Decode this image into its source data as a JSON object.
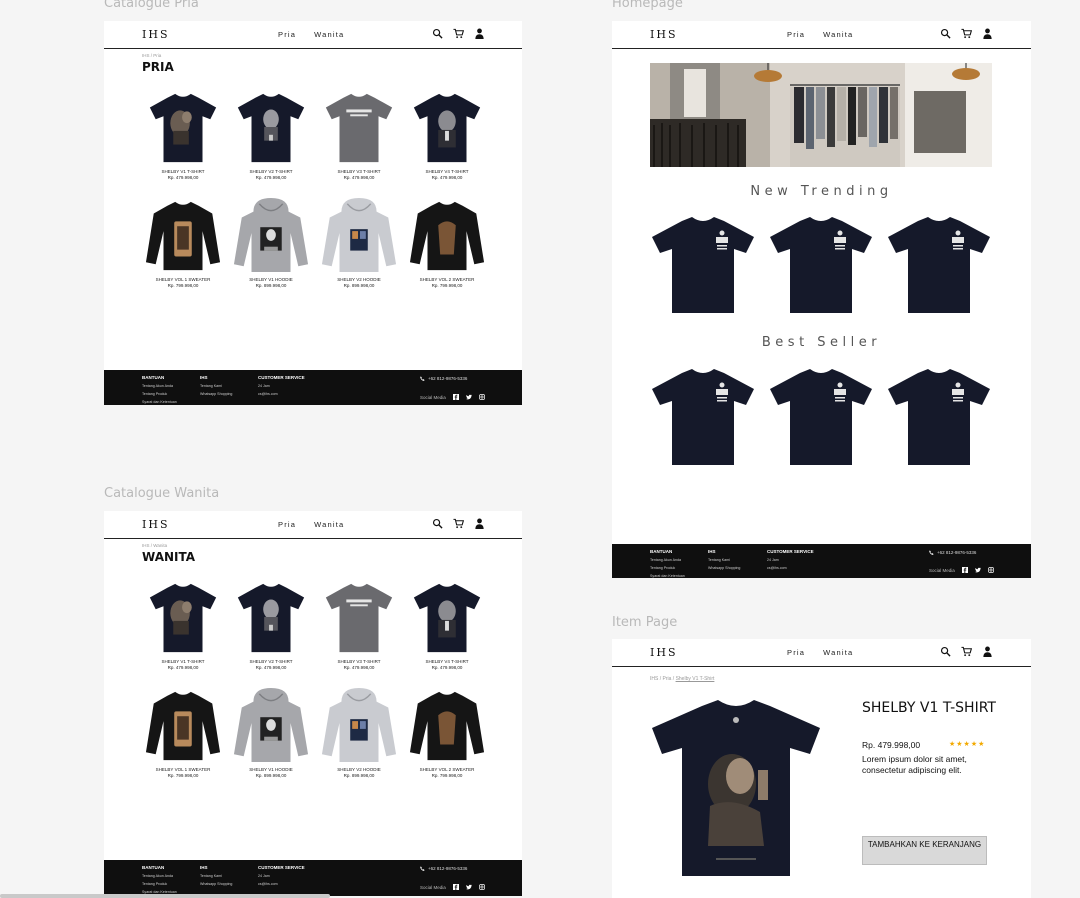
{
  "brand": "IHS",
  "nav": [
    "Pria",
    "Wanita"
  ],
  "frames": {
    "catalogue_pria": {
      "label": "Catalogue Pria",
      "breadcrumb": "IHS / Pria",
      "title": "PRIA",
      "products": [
        {
          "name": "SHELBY V1 T-SHIRT",
          "price": "Rp. 479.998,00",
          "kind": "tee-dark",
          "art": "portrait1"
        },
        {
          "name": "SHELBY V2 T-SHIRT",
          "price": "Rp. 479.998,00",
          "kind": "tee-dark",
          "art": "portrait2"
        },
        {
          "name": "SHELBY V3 T-SHIRT",
          "price": "Rp. 479.998,00",
          "kind": "tee-grey",
          "art": "text"
        },
        {
          "name": "SHELBY V4 T-SHIRT",
          "price": "Rp. 479.998,00",
          "kind": "tee-dark",
          "art": "portrait3"
        },
        {
          "name": "SHELBY VOL 1 SWEATER",
          "price": "Rp. 799.998,00",
          "kind": "sweater",
          "art": "tan"
        },
        {
          "name": "SHELBY V1 HOODIE",
          "price": "Rp. 899.998,00",
          "kind": "hoodie-grey",
          "art": "photo"
        },
        {
          "name": "SHELBY V2 HOODIE",
          "price": "Rp. 899.998,00",
          "kind": "hoodie-light",
          "art": "poster"
        },
        {
          "name": "SHELBY VOL 2 SWEATER",
          "price": "Rp. 799.998,00",
          "kind": "sweater",
          "art": "brown"
        }
      ]
    },
    "catalogue_wanita": {
      "label": "Catalogue Wanita",
      "breadcrumb": "IHS / Wanita",
      "title": "WANITA",
      "products": [
        {
          "name": "SHELBY V1 T-SHIRT",
          "price": "Rp. 479.998,00",
          "kind": "tee-dark",
          "art": "portrait1"
        },
        {
          "name": "SHELBY V2 T-SHIRT",
          "price": "Rp. 479.998,00",
          "kind": "tee-dark",
          "art": "portrait2"
        },
        {
          "name": "SHELBY V3 T-SHIRT",
          "price": "Rp. 479.998,00",
          "kind": "tee-grey",
          "art": "text"
        },
        {
          "name": "SHELBY V4 T-SHIRT",
          "price": "Rp. 479.998,00",
          "kind": "tee-dark",
          "art": "portrait3"
        },
        {
          "name": "SHELBY VOL 1 SWEATER",
          "price": "Rp. 799.998,00",
          "kind": "sweater",
          "art": "tan"
        },
        {
          "name": "SHELBY V1 HOODIE",
          "price": "Rp. 899.998,00",
          "kind": "hoodie-grey",
          "art": "photo"
        },
        {
          "name": "SHELBY V2 HOODIE",
          "price": "Rp. 899.998,00",
          "kind": "hoodie-light",
          "art": "poster"
        },
        {
          "name": "SHELBY VOL 2 SWEATER",
          "price": "Rp. 799.998,00",
          "kind": "sweater",
          "art": "brown"
        }
      ]
    },
    "homepage": {
      "label": "Homepage",
      "new_trending": "New Trending",
      "best_seller": "Best Seller"
    },
    "item_page": {
      "label": "Item Page",
      "breadcrumb_base": "IHS / Pria / ",
      "breadcrumb_current": "Shelby V1 T-Shirt",
      "title": "SHELBY V1 T-SHIRT",
      "price": "Rp. 479.998,00",
      "rating": 5,
      "stars": "★★★★★",
      "description": "Lorem ipsum dolor sit amet, consectetur adipiscing elit.",
      "button": "TAMBAHKAN KE KERANJANG"
    }
  },
  "footer": {
    "bantuan_head": "BANTUAN",
    "bantuan_items": [
      "Tentang Akun Anda",
      "Tentang Produk",
      "Syarat dan Ketentuan"
    ],
    "ihs_head": "IHS",
    "ihs_items": [
      "Tentang Kami",
      "Whatsapp Shopping"
    ],
    "cs_head": "CUSTOMER SERVICE",
    "cs_items": [
      "24 Jam",
      "cs@ihs.com"
    ],
    "phone": "+62 812-9876-5336",
    "social": "Social Media"
  },
  "colors": {
    "footer_bg": "#0f0f0f",
    "tee_dark": "#15192a",
    "tee_grey": "#6a6a6e",
    "hoodie_grey": "#a6a7ab",
    "hoodie_light": "#c9cbd0",
    "sweater": "#151515",
    "star": "#f2a900"
  }
}
